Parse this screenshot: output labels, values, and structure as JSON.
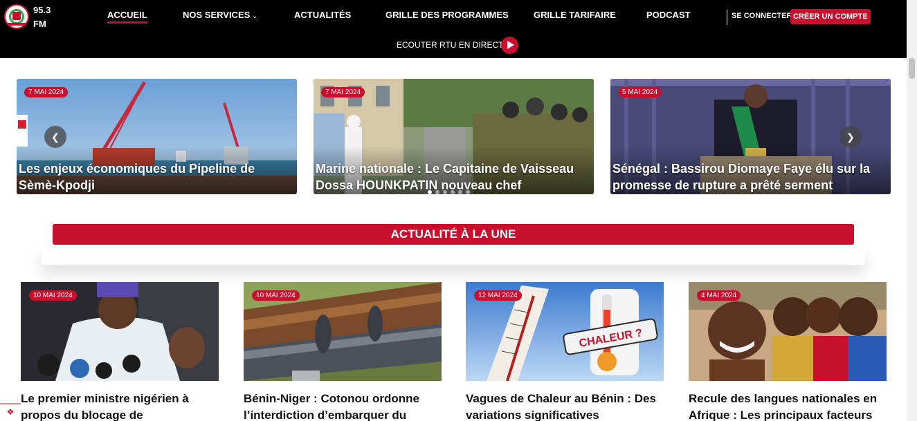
{
  "header": {
    "frequency": "95.3\nFM",
    "frequency_line1": "95.3",
    "frequency_line2": "FM",
    "nav": {
      "home": "ACCUEIL",
      "services": "NOS SERVICES",
      "news": "ACTUALITÉS",
      "schedule": "GRILLE DES PROGRAMMES",
      "rates": "GRILLE TARIFAIRE",
      "podcast": "PODCAST"
    },
    "login": "SE CONNECTER",
    "signup": "CRÉER UN COMPTE",
    "listen_live": "ECOUTER RTU EN DIRECT"
  },
  "carousel": [
    {
      "date": "7 MAI 2024",
      "title": "Les enjeux économiques du Pipeline de Sèmè-Kpodji"
    },
    {
      "date": "7 MAI 2024",
      "title": "Marine nationale : Le Capitaine de Vaisseau Dossa HOUNKPATIN nouveau chef"
    },
    {
      "date": "5 MAI 2024",
      "title": "Sénégal : Bassirou Diomaye Faye élu sur la promesse de rupture a prêté serment"
    }
  ],
  "section_title": "ACTUALITÉ À LA UNE",
  "cards": [
    {
      "date": "10 MAI 2024",
      "title": "Le premier ministre nigérien à propos du blocage de"
    },
    {
      "date": "10 MAI 2024",
      "title": "Bénin-Niger : Cotonou ordonne l’interdiction d’embarquer du"
    },
    {
      "date": "12 MAI 2024",
      "title": "Vagues de Chaleur au Bénin : Des variations significatives"
    },
    {
      "date": "4 MAI 2024",
      "title": "Recule des langues nationales en Afrique : Les principaux facteurs"
    }
  ],
  "thumbnail_text": {
    "heat": "CHALEUR ?"
  },
  "colors": {
    "brand_red": "#c8102e",
    "header_bg": "#000000"
  }
}
